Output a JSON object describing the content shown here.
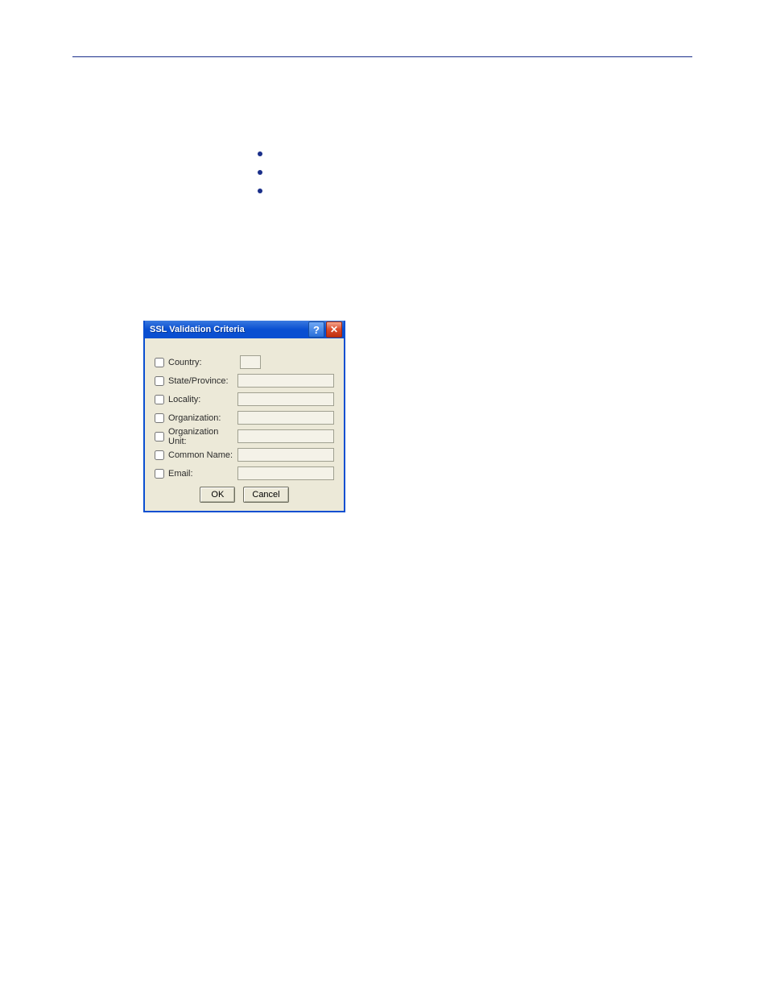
{
  "dialog": {
    "title": "SSL Validation Criteria",
    "help_symbol": "?",
    "close_symbol": "✕",
    "fields": {
      "country": {
        "label": "Country:",
        "value": ""
      },
      "state": {
        "label": "State/Province:",
        "value": ""
      },
      "locality": {
        "label": "Locality:",
        "value": ""
      },
      "organization": {
        "label": "Organization:",
        "value": ""
      },
      "org_unit": {
        "label": "Organization Unit:",
        "value": ""
      },
      "common_name": {
        "label": "Common Name:",
        "value": ""
      },
      "email": {
        "label": "Email:",
        "value": ""
      }
    },
    "buttons": {
      "ok": "OK",
      "cancel": "Cancel"
    }
  }
}
